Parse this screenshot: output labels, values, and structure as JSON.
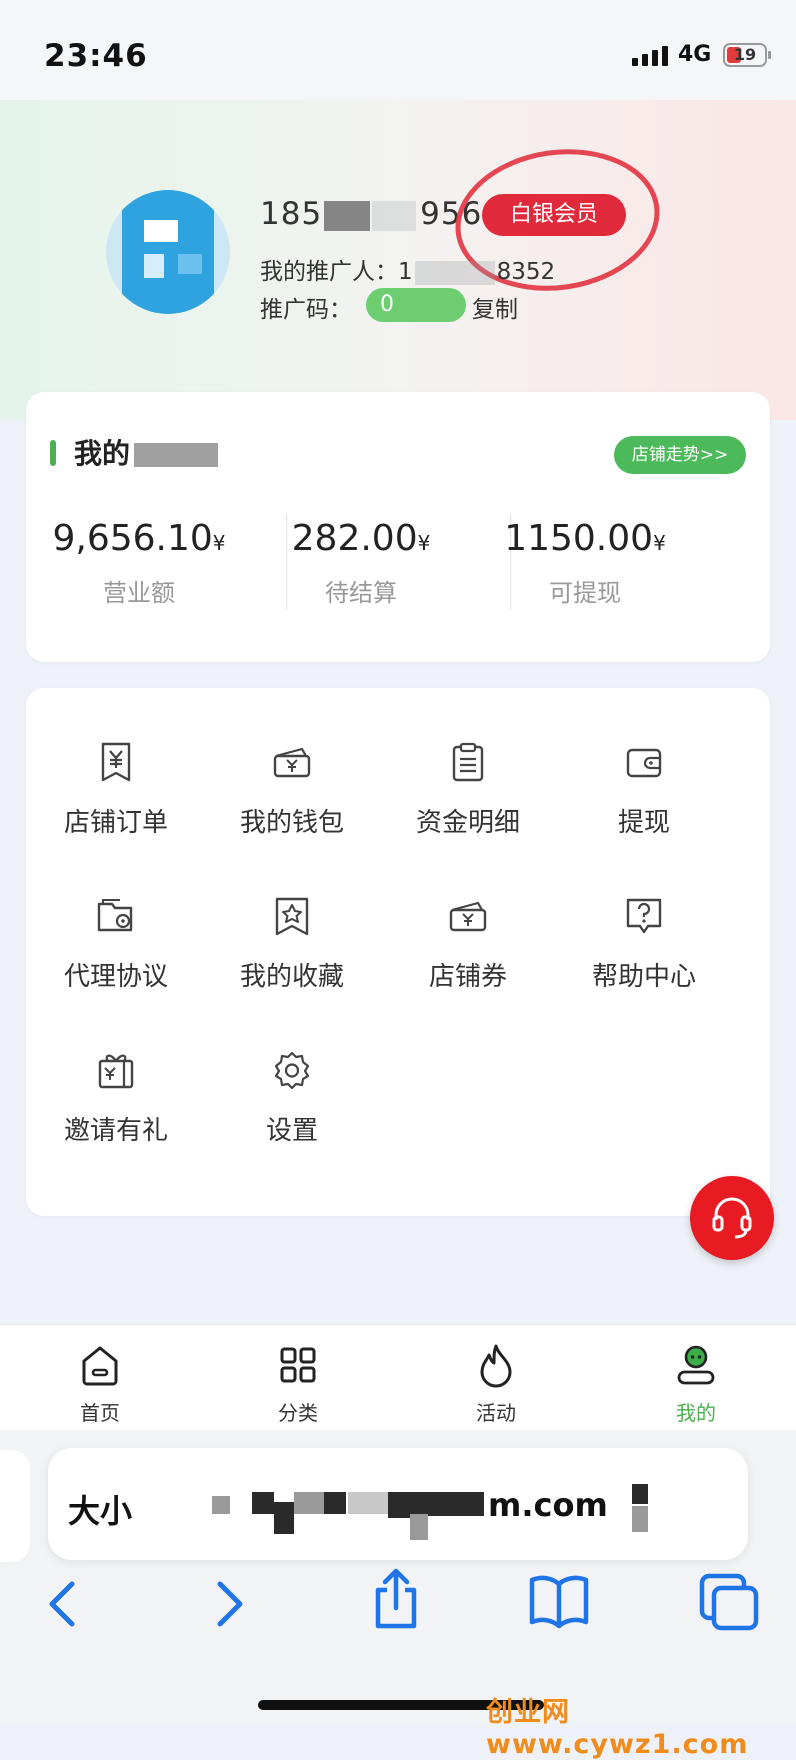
{
  "status_bar": {
    "time": "23:46",
    "network": "4G",
    "battery": "19"
  },
  "profile": {
    "phone_prefix": "185",
    "phone_suffix": "9564",
    "member_level": "白银会员",
    "promoter_label": "我的推广人：",
    "promoter_prefix": "1",
    "promoter_suffix": "8352",
    "promo_code_label": "推广码：",
    "promo_code_value": "0",
    "copy_label": "复制"
  },
  "shop": {
    "title": "我的",
    "trend_button": "店铺走势>>",
    "currency": "¥",
    "stats": [
      {
        "value": "9,656.10",
        "label": "营业额"
      },
      {
        "value": "282.00",
        "label": "待结算"
      },
      {
        "value": "1150.00",
        "label": "可提现"
      }
    ]
  },
  "menu": {
    "items": [
      {
        "label": "店铺订单",
        "icon": "receipt-yen-icon"
      },
      {
        "label": "我的钱包",
        "icon": "wallet-ticket-icon"
      },
      {
        "label": "资金明细",
        "icon": "clipboard-list-icon"
      },
      {
        "label": "提现",
        "icon": "wallet-icon"
      },
      {
        "label": "代理协议",
        "icon": "folder-agreement-icon"
      },
      {
        "label": "我的收藏",
        "icon": "bookmark-star-icon"
      },
      {
        "label": "店铺券",
        "icon": "coupon-yen-icon"
      },
      {
        "label": "帮助中心",
        "icon": "help-chat-icon"
      },
      {
        "label": "邀请有礼",
        "icon": "gift-yen-icon"
      },
      {
        "label": "设置",
        "icon": "gear-icon"
      }
    ]
  },
  "support": {
    "icon": "headset-icon",
    "color": "#e81b22"
  },
  "tabbar": {
    "tabs": [
      {
        "label": "首页",
        "icon": "home-icon"
      },
      {
        "label": "分类",
        "icon": "grid-icon"
      },
      {
        "label": "活动",
        "icon": "flame-icon"
      },
      {
        "label": "我的",
        "icon": "user-icon",
        "active": true
      }
    ]
  },
  "browser": {
    "url_prefix": "大小",
    "url_suffix": "m.com"
  },
  "watermark": "创业网www.cywz1.com",
  "colors": {
    "accent_green": "#4caf50",
    "badge_red": "#e02a3c"
  }
}
